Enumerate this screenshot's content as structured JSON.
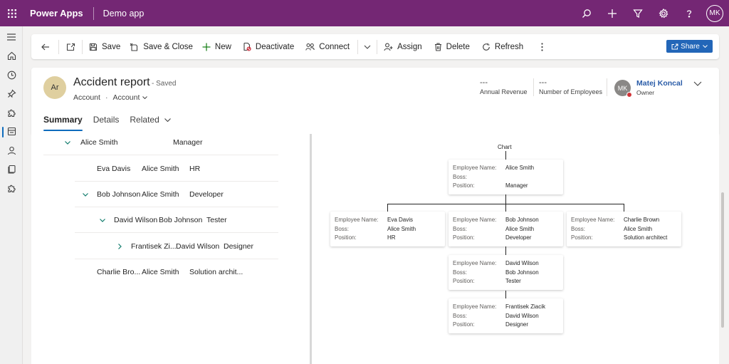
{
  "topbar": {
    "app_name": "Power Apps",
    "app_module": "Demo app",
    "icons": [
      "waffle-icon",
      "search-icon",
      "plus-icon",
      "filter-icon",
      "settings-gear-icon",
      "help-icon"
    ],
    "user_initials": "MK",
    "brand_color": "#742774"
  },
  "rail": {
    "items": [
      "hamburger-menu-icon",
      "home-icon",
      "recent-clock-icon",
      "pinned-icon",
      "puzzle-icon",
      "accounts-icon",
      "contacts-person-icon",
      "document-icon",
      "puzzle-icon"
    ],
    "active_index": 5
  },
  "commandbar": {
    "back_icon": "back-arrow-icon",
    "popout_icon": "open-new-window-icon",
    "save": "Save",
    "save_close": "Save & Close",
    "new": "New",
    "deactivate": "Deactivate",
    "connect": "Connect",
    "assign": "Assign",
    "delete": "Delete",
    "refresh": "Refresh",
    "share": "Share"
  },
  "header": {
    "entity_initials": "Ar",
    "title": "Accident report",
    "status": "- Saved",
    "entity": "Account",
    "form": "Account",
    "fields": [
      {
        "value": "---",
        "label": "Annual Revenue"
      },
      {
        "value": "---",
        "label": "Number of Employees"
      }
    ],
    "owner": {
      "initials": "MK",
      "name": "Matej Koncal",
      "role": "Owner"
    },
    "tabs": [
      "Summary",
      "Details",
      "Related"
    ]
  },
  "tree": [
    {
      "name": "Alice Smith",
      "boss": "",
      "position": "Manager",
      "expanded": true
    },
    {
      "name": "Eva Davis",
      "boss": "Alice Smith",
      "position": "HR"
    },
    {
      "name": "Bob Johnson",
      "boss": "Alice Smith",
      "position": "Developer",
      "expanded": true
    },
    {
      "name": "David Wilson",
      "boss": "Bob Johnson",
      "position": "Tester",
      "expanded": true
    },
    {
      "name": "Frantisek Zi...",
      "boss": "David Wilson",
      "position": "Designer",
      "expanded": false
    },
    {
      "name": "Charlie Bro...",
      "boss": "Alice Smith",
      "position": "Solution archit..."
    }
  ],
  "chart": {
    "title": "Chart",
    "field_labels": {
      "name": "Employee Name:",
      "boss": "Boss:",
      "position": "Position:"
    },
    "cards": [
      {
        "name": "Alice Smith",
        "boss": "",
        "position": "Manager"
      },
      {
        "name": "Eva Davis",
        "boss": "Alice Smith",
        "position": "HR"
      },
      {
        "name": "Bob Johnson",
        "boss": "Alice Smith",
        "position": "Developer"
      },
      {
        "name": "Charlie Brown",
        "boss": "Alice Smith",
        "position": "Solution architect"
      },
      {
        "name": "David Wilson",
        "boss": "Bob Johnson",
        "position": "Tester"
      },
      {
        "name": "Frantisek Ziacik",
        "boss": "David Wilson",
        "position": "Designer"
      }
    ]
  }
}
